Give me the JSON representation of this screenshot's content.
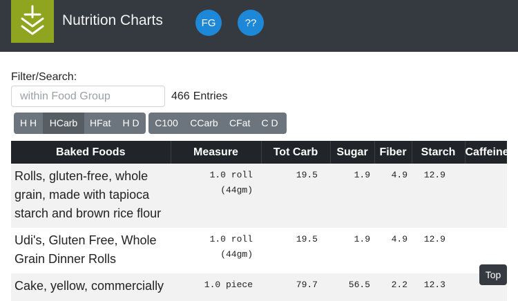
{
  "header": {
    "title": "Nutrition Charts",
    "logo_icon": "download-chevrons-icon",
    "fg_label": "FG",
    "help_label": "??",
    "accent_color": "#1e88d8",
    "logo_color": "#8fa51f"
  },
  "filter": {
    "label": "Filter/Search:",
    "placeholder": "within Food Group",
    "value": "",
    "entry_count": "466",
    "entry_label": "Entries"
  },
  "sort_groups": [
    {
      "buttons": [
        {
          "label": "H H",
          "active": false
        },
        {
          "label": "HCarb",
          "active": true
        },
        {
          "label": "HFat",
          "active": false
        },
        {
          "label": "H D",
          "active": false
        }
      ]
    },
    {
      "buttons": [
        {
          "label": "C100",
          "active": false
        },
        {
          "label": "CCarb",
          "active": false
        },
        {
          "label": "CFat",
          "active": false
        },
        {
          "label": "C D",
          "active": false
        }
      ]
    }
  ],
  "table": {
    "columns": [
      "Baked Foods",
      "Measure",
      "Tot Carb",
      "Sugar",
      "Fiber",
      "Starch",
      "Caffeine"
    ],
    "rows": [
      {
        "name": "Rolls, gluten-free, whole grain, made with tapioca starch and brown rice flour",
        "measure_qty": "1.0 roll",
        "measure_unit": "(44gm)",
        "tot_carb": "19.5",
        "sugar": "1.9",
        "fiber": "4.9",
        "starch": "12.9",
        "caffeine": ""
      },
      {
        "name": "Udi's, Gluten Free, Whole Grain Dinner Rolls",
        "measure_qty": "1.0 roll",
        "measure_unit": "(44gm)",
        "tot_carb": "19.5",
        "sugar": "1.9",
        "fiber": "4.9",
        "starch": "12.9",
        "caffeine": ""
      },
      {
        "name": "Cake, yellow, commercially",
        "measure_qty": "1.0 piece",
        "measure_unit": "",
        "tot_carb": "79.7",
        "sugar": "56.5",
        "fiber": "2.2",
        "starch": "12.3",
        "caffeine": ""
      }
    ]
  },
  "top_button_label": "Top"
}
